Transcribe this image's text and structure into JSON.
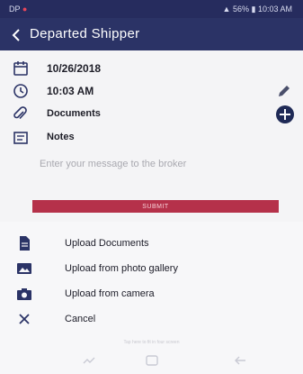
{
  "status_bar": {
    "left": "DP",
    "battery": "56%",
    "time": "10:03 AM"
  },
  "header": {
    "title": "Departed Shipper"
  },
  "form": {
    "date": "10/26/2018",
    "time": "10:03 AM",
    "documents_label": "Documents",
    "notes_label": "Notes",
    "message_placeholder": "Enter your message to the broker",
    "submit_label": "SUBMIT"
  },
  "sheet": {
    "options": [
      {
        "label": "Upload Documents",
        "icon": "document-icon"
      },
      {
        "label": "Upload from photo gallery",
        "icon": "gallery-icon"
      },
      {
        "label": "Upload from camera",
        "icon": "camera-icon"
      },
      {
        "label": "Cancel",
        "icon": "close-icon"
      }
    ],
    "hint": "Tap here to fit in four screen"
  },
  "colors": {
    "header": "#2b3366",
    "status_bar": "#262c5e",
    "submit": "#b5314a",
    "icon": "#2b3366"
  }
}
